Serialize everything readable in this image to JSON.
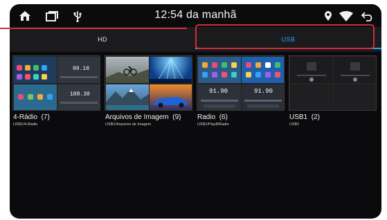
{
  "status_bar": {
    "time": "12:54 da manhã",
    "icons": [
      "home-icon",
      "recent-apps-icon",
      "usb-icon",
      "location-icon",
      "wifi-icon",
      "back-icon"
    ]
  },
  "tabs": [
    {
      "label": "HD",
      "selected": false
    },
    {
      "label": "USB",
      "selected": true
    }
  ],
  "colors": {
    "accent": "#2aa6f2",
    "highlight": "#d22d3a",
    "background": "#0b0b0d",
    "tab_bar": "#1b1b1e"
  },
  "folders": [
    {
      "name": "4-Rádio",
      "count": "(7)",
      "path": "USB1/4-Rádio",
      "thumb_readouts": [
        "99.10",
        "108.30"
      ]
    },
    {
      "name": "Arquivos de Imagem",
      "count": "(9)",
      "path": "USB1/Arquivos de Imagem"
    },
    {
      "name": "Radio",
      "count": "(6)",
      "path": "USB1/Play8/Radio",
      "thumb_readouts": [
        "91.90",
        "91.90"
      ]
    },
    {
      "name": "USB1",
      "count": "(2)",
      "path": "USB1"
    }
  ]
}
